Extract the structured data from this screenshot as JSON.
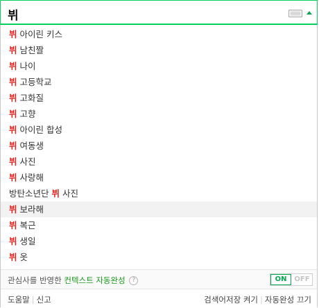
{
  "search": {
    "query": "뷔"
  },
  "suggestions": [
    {
      "keyword": "뷔",
      "prefix": "",
      "suffix": "아이린 키스"
    },
    {
      "keyword": "뷔",
      "prefix": "",
      "suffix": "남친짤"
    },
    {
      "keyword": "뷔",
      "prefix": "",
      "suffix": "나이"
    },
    {
      "keyword": "뷔",
      "prefix": "",
      "suffix": "고등학교"
    },
    {
      "keyword": "뷔",
      "prefix": "",
      "suffix": "고화질"
    },
    {
      "keyword": "뷔",
      "prefix": "",
      "suffix": "고향"
    },
    {
      "keyword": "뷔",
      "prefix": "",
      "suffix": "아이린 합성"
    },
    {
      "keyword": "뷔",
      "prefix": "",
      "suffix": "여동생"
    },
    {
      "keyword": "뷔",
      "prefix": "",
      "suffix": "사진"
    },
    {
      "keyword": "뷔",
      "prefix": "",
      "suffix": "사랑해"
    },
    {
      "keyword": "뷔",
      "prefix": "방탄소년단",
      "suffix": "사진"
    },
    {
      "keyword": "뷔",
      "prefix": "",
      "suffix": "보라해"
    },
    {
      "keyword": "뷔",
      "prefix": "",
      "suffix": "복근"
    },
    {
      "keyword": "뷔",
      "prefix": "",
      "suffix": "생일"
    },
    {
      "keyword": "뷔",
      "prefix": "",
      "suffix": "옷"
    }
  ],
  "highlighted_index": 11,
  "context": {
    "text": "관심사를 반영한",
    "link": "컨텍스트 자동완성",
    "help": "?",
    "toggle_on": "ON",
    "toggle_off": "OFF"
  },
  "footer": {
    "help": "도움말",
    "report": "신고",
    "history_on": "검색어저장 켜기",
    "autocomplete_off": "자동완성 끄기"
  },
  "colors": {
    "accent": "#03cf5d",
    "keyword": "#e4241f",
    "context_link": "#1c9b1e"
  },
  "icons": {
    "keyboard": "keyboard-icon",
    "collapse": "arrow-up-icon",
    "help": "help-icon"
  }
}
